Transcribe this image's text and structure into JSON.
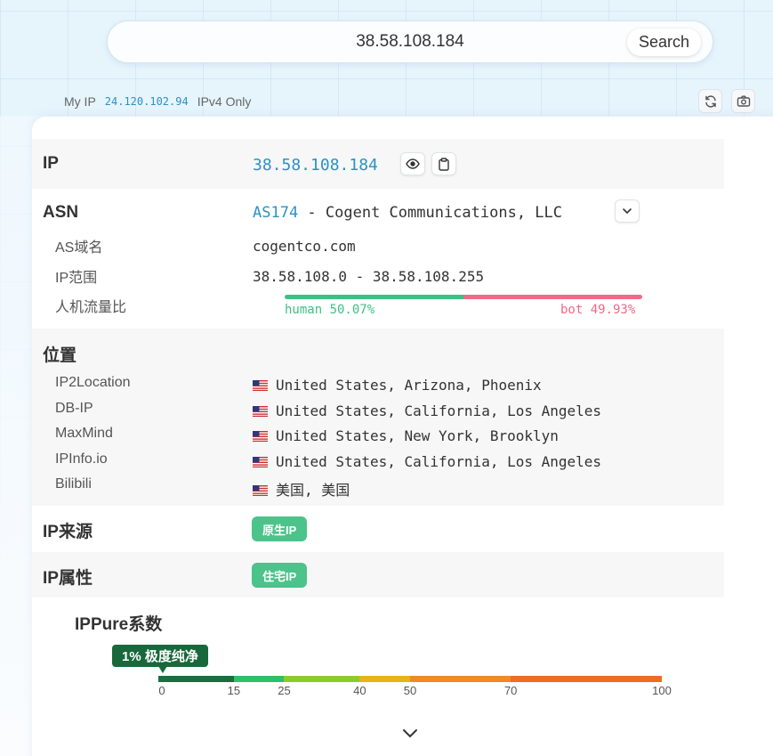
{
  "search": {
    "value": "38.58.108.184",
    "button_label": "Search"
  },
  "myip": {
    "label": "My IP",
    "value": "24.120.102.94",
    "mode": "IPv4 Only"
  },
  "icons": {
    "refresh": "refresh-icon",
    "camera": "camera-icon",
    "eye": "eye-icon",
    "clipboard": "clipboard-icon",
    "chevron": "chevron-down-icon"
  },
  "ip": {
    "label": "IP",
    "value": "38.58.108.184"
  },
  "asn": {
    "label": "ASN",
    "as_number": "AS174",
    "as_name": " - Cogent Communications, LLC",
    "domain_label": "AS域名",
    "domain_value": "cogentco.com",
    "range_label": "IP范围",
    "range_value": "38.58.108.0 - 38.58.108.255",
    "traffic_label": "人机流量比",
    "human_text": "human 50.07%",
    "bot_text": "bot 49.93%",
    "human_fraction": 0.5007,
    "human_color": "#3fbf85",
    "bot_color": "#f06a86"
  },
  "location": {
    "label": "位置",
    "rows": [
      {
        "source": "IP2Location",
        "value": "United States, Arizona, Phoenix"
      },
      {
        "source": "DB-IP",
        "value": "United States, California, Los Angeles"
      },
      {
        "source": "MaxMind",
        "value": "United States, New York, Brooklyn"
      },
      {
        "source": "IPInfo.io",
        "value": "United States, California, Los Angeles"
      },
      {
        "source": "Bilibili",
        "value": "美国, 美国"
      }
    ]
  },
  "origin": {
    "label": "IP来源",
    "badge": "原生IP"
  },
  "attribute": {
    "label": "IP属性",
    "badge": "住宅IP"
  },
  "purity": {
    "label": "IPPure系数",
    "score_badge": "1% 极度纯净",
    "score": 1,
    "ticks": [
      "0",
      "15",
      "25",
      "40",
      "50",
      "70",
      "100"
    ],
    "segment_colors": [
      "#1b6e3f",
      "#2ebf6a",
      "#8ccc2a",
      "#e6b514",
      "#f08a24",
      "#f06b25",
      "#dc3535"
    ]
  },
  "accent_color": "#2b92c6",
  "badge_color": "#4cc38a"
}
